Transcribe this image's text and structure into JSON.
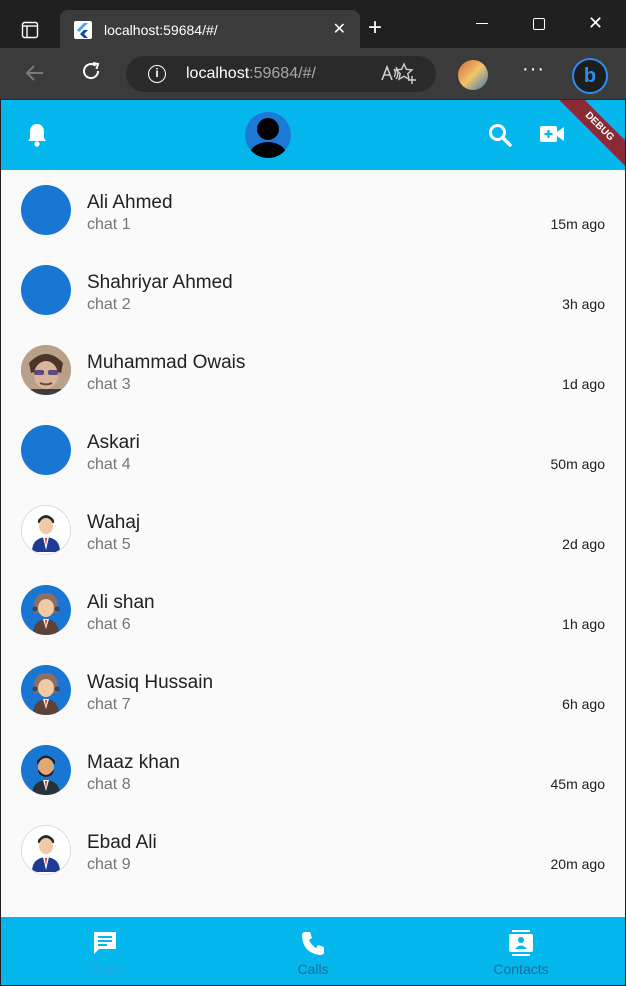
{
  "browser": {
    "tab_title": "localhost:59684/#/",
    "url_host": "localhost",
    "url_rest": ":59684/#/",
    "close_glyph": "✕",
    "newtab_glyph": "+",
    "more_glyph": "···",
    "bing_glyph": "b"
  },
  "app": {
    "debug_banner": "DEBUG",
    "colors": {
      "primary": "#03b6ec",
      "avatar_blue": "#1976d2",
      "background": "#fafafa"
    },
    "chats": [
      {
        "name": "Ali Ahmed",
        "preview": "chat 1",
        "time": "15m ago",
        "avatar": "blue"
      },
      {
        "name": "Shahriyar Ahmed",
        "preview": "chat 2",
        "time": "3h ago",
        "avatar": "blue"
      },
      {
        "name": "Muhammad Owais",
        "preview": "chat 3",
        "time": "1d ago",
        "avatar": "photo"
      },
      {
        "name": "Askari",
        "preview": "chat 4",
        "time": "50m ago",
        "avatar": "blue"
      },
      {
        "name": "Wahaj",
        "preview": "chat 5",
        "time": "2d ago",
        "avatar": "man-suit"
      },
      {
        "name": "Ali shan",
        "preview": "chat 6",
        "time": "1h ago",
        "avatar": "woman-headset"
      },
      {
        "name": "Wasiq Hussain",
        "preview": "chat 7",
        "time": "6h ago",
        "avatar": "woman-headset"
      },
      {
        "name": "Maaz khan",
        "preview": "chat 8",
        "time": "45m ago",
        "avatar": "man-beard"
      },
      {
        "name": "Ebad Ali",
        "preview": "chat 9",
        "time": "20m ago",
        "avatar": "man-suit"
      }
    ],
    "bottom_nav": [
      {
        "label": "Chats",
        "icon": "chat-icon",
        "active": true
      },
      {
        "label": "Calls",
        "icon": "phone-icon",
        "active": false
      },
      {
        "label": "Contacts",
        "icon": "contacts-icon",
        "active": false
      }
    ]
  }
}
